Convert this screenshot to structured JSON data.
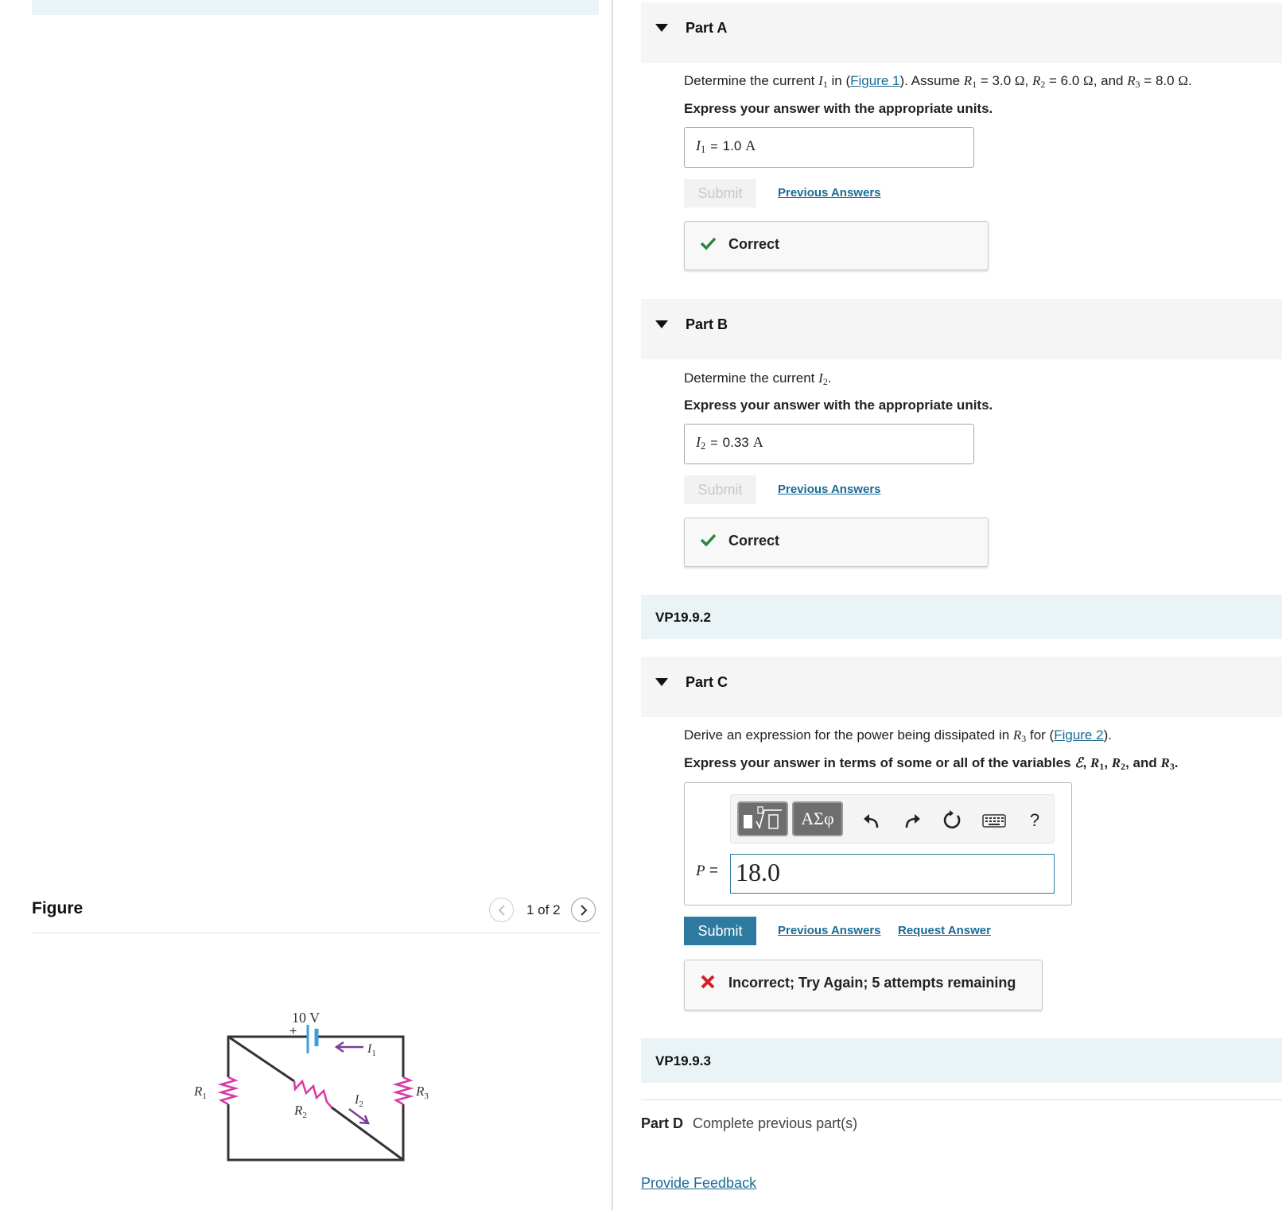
{
  "figure_panel": {
    "title": "Figure",
    "counter": "1 of 2",
    "circuit": {
      "battery_label": "10 V",
      "plus_sign": "+",
      "i1_label": "I",
      "i1_sub": "1",
      "i2_label": "I",
      "i2_sub": "2",
      "r1_label": "R",
      "r1_sub": "1",
      "r2_label": "R",
      "r2_sub": "2",
      "r3_label": "R",
      "r3_sub": "3"
    }
  },
  "partA": {
    "title": "Part A",
    "q_pre": "Determine the current ",
    "q_var": "I",
    "q_var_sub": "1",
    "q_in": " in (",
    "q_link": "Figure 1",
    "q_assume": "). Assume ",
    "r1": "R",
    "r1_sub": "1",
    "r1_val": " = 3.0 ",
    "ohm": "Ω",
    "comma": ", ",
    "r2": "R",
    "r2_sub": "2",
    "r2_val": " = 6.0 ",
    "and": ", and ",
    "r3": "R",
    "r3_sub": "3",
    "r3_val": " = 8.0 ",
    "period": ".",
    "instruction": "Express your answer with the appropriate units.",
    "answer_var": "I",
    "answer_sub": "1",
    "answer_eq": "=",
    "answer_value": "1.0",
    "answer_unit": "A",
    "submit": "Submit",
    "prev_answers": "Previous Answers",
    "feedback": "Correct"
  },
  "partB": {
    "title": "Part B",
    "q_pre": "Determine the current ",
    "q_var": "I",
    "q_var_sub": "2",
    "q_end": ".",
    "instruction": "Express your answer with the appropriate units.",
    "answer_var": "I",
    "answer_sub": "2",
    "answer_eq": "=",
    "answer_value": "0.33",
    "answer_unit": "A",
    "submit": "Submit",
    "prev_answers": "Previous Answers",
    "feedback": "Correct"
  },
  "vp1": "VP19.9.2",
  "partC": {
    "title": "Part C",
    "q_pre": "Derive an expression for the power being dissipated in ",
    "q_var": "R",
    "q_var_sub": "3",
    "q_for": " for (",
    "q_link": "Figure 2",
    "q_end": ").",
    "instr_pre": "Express your answer in terms of some or all of the variables ",
    "instr_emf": "ℰ",
    "instr_c1": ", ",
    "instr_r1": "R",
    "instr_r1_sub": "1",
    "instr_c2": ", ",
    "instr_r2": "R",
    "instr_r2_sub": "2",
    "instr_and": ", and ",
    "instr_r3": "R",
    "instr_r3_sub": "3",
    "instr_end": ".",
    "toolbar": {
      "symbols_label": "ΑΣφ",
      "help_label": "?"
    },
    "answer_var": "P",
    "answer_eq": " =",
    "answer_value": "18.0",
    "submit": "Submit",
    "prev_answers": "Previous Answers",
    "request_answer": "Request Answer",
    "feedback": "Incorrect; Try Again; 5 attempts remaining"
  },
  "vp2": "VP19.9.3",
  "partD": {
    "title": "Part D",
    "message": "Complete previous part(s)"
  },
  "provide_feedback": "Provide Feedback",
  "colors": {
    "link": "#1a6b96",
    "submit_active": "#2c7aa0",
    "correct": "#2e8540",
    "incorrect": "#d0202a",
    "resistor": "#d63aa8",
    "arrow": "#7b3f9a",
    "battery": "#3aa0d8"
  }
}
